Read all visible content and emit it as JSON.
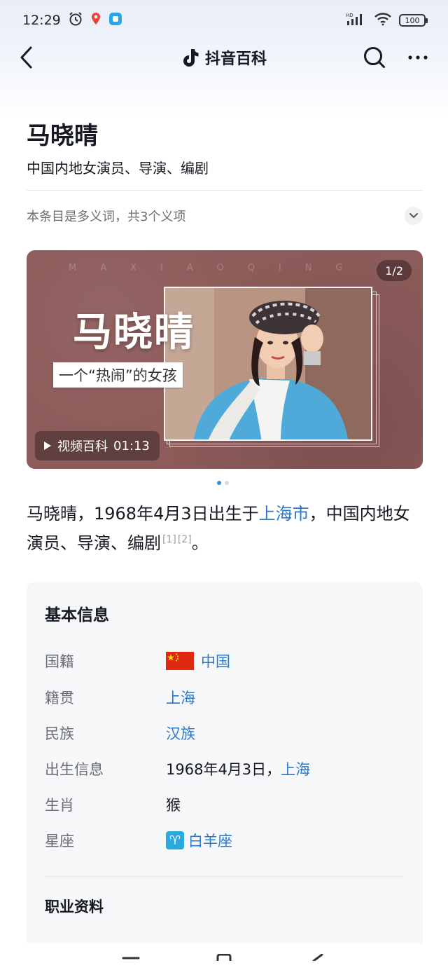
{
  "status_bar": {
    "time": "12:29",
    "network": "HD",
    "battery": "100"
  },
  "nav": {
    "title": "抖音百科"
  },
  "entry": {
    "title": "马晓晴",
    "subtitle": "中国内地女演员、导演、编剧",
    "polysemy_note": "本条目是多义词，共3个义项"
  },
  "media": {
    "watermark": "MAXIAOQING",
    "counter": "1/2",
    "big_title": "马晓晴",
    "caption": "一个“热闹”的女孩",
    "video_label": "视频百科",
    "video_duration": "01:13",
    "page_count": 2,
    "active_page": 1
  },
  "summary": {
    "part1": "马晓晴，1968年4月3日出生于",
    "link": "上海市",
    "part2": "，中国内地女演员、导演、编剧",
    "ref1": "[1]",
    "ref2": "[2]",
    "end": "。"
  },
  "basic_info": {
    "heading": "基本信息",
    "rows": [
      {
        "key": "国籍",
        "value": "中国"
      },
      {
        "key": "籍贯",
        "value": "上海"
      },
      {
        "key": "民族",
        "value": "汉族"
      },
      {
        "key": "出生信息",
        "value": "1968年4月3日，",
        "link": "上海"
      },
      {
        "key": "生肖",
        "value": "猴"
      },
      {
        "key": "星座",
        "value": "白羊座",
        "icon_glyph": "♈"
      }
    ],
    "career_heading": "职业资料"
  },
  "colors": {
    "link": "#2c78c8",
    "card_bg": "#f6f7f9",
    "media_bg": "#8c5b5a",
    "flag_red": "#de2910",
    "zodiac_blue": "#2aa8e0"
  }
}
